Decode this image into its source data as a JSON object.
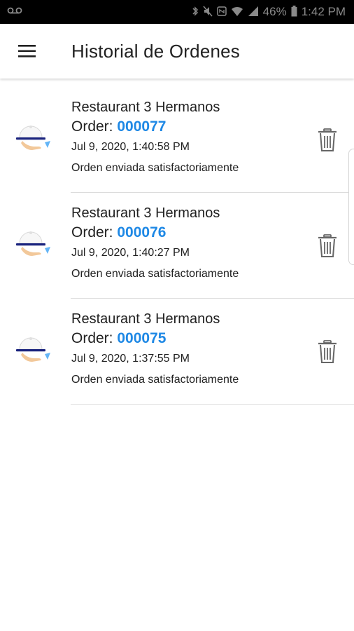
{
  "status_bar": {
    "left_icon": "voicemail-icon",
    "battery_percent": "46%",
    "time": "1:42 PM",
    "icons": [
      "bluetooth-icon",
      "mute-icon",
      "nfc-icon",
      "wifi-icon",
      "signal-icon",
      "battery-icon"
    ]
  },
  "app_bar": {
    "title": "Historial de Ordenes",
    "menu_icon": "hamburger-menu-icon"
  },
  "colors": {
    "accent": "#1e88e5",
    "text": "#212121",
    "divider": "#dcdcdc"
  },
  "orders": [
    {
      "restaurant": "Restaurant 3 Hermanos",
      "order_label": "Order: ",
      "order_number": "000077",
      "date": "Jul 9, 2020, 1:40:58 PM",
      "status": "Orden enviada satisfactoriamente"
    },
    {
      "restaurant": "Restaurant 3 Hermanos",
      "order_label": "Order: ",
      "order_number": "000076",
      "date": "Jul 9, 2020, 1:40:27 PM",
      "status": "Orden enviada satisfactoriamente"
    },
    {
      "restaurant": "Restaurant 3 Hermanos",
      "order_label": "Order: ",
      "order_number": "000075",
      "date": "Jul 9, 2020, 1:37:55 PM",
      "status": "Orden enviada satisfactoriamente"
    }
  ]
}
